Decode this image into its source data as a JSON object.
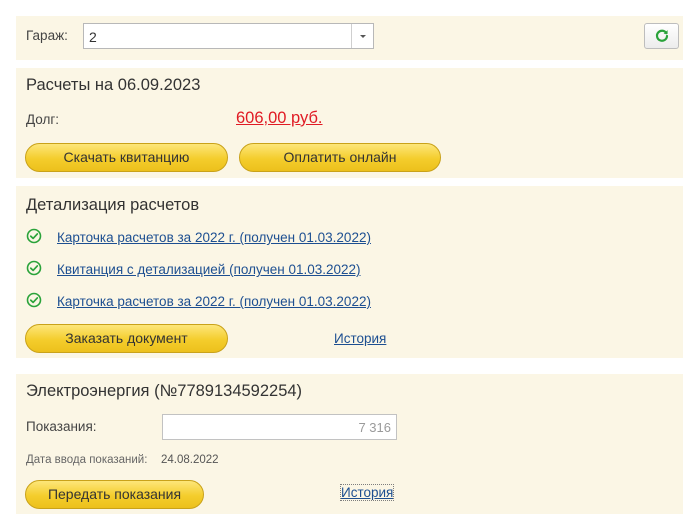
{
  "garage": {
    "label": "Гараж:",
    "selected": "2"
  },
  "calc": {
    "title": "Расчеты на 06.09.2023",
    "debt_label": "Долг:",
    "debt_value": "606,00 руб.",
    "download_label": "Скачать квитанцию",
    "pay_label": "Оплатить онлайн"
  },
  "detail": {
    "title": "Детализация расчетов",
    "documents": [
      {
        "label": "Карточка расчетов за 2022 г. (получен 01.03.2022)"
      },
      {
        "label": "Квитанция с детализацией (получен 01.03.2022)"
      },
      {
        "label": "Карточка расчетов за 2022 г. (получен 01.03.2022)"
      }
    ],
    "order_label": "Заказать документ",
    "history_label": "История"
  },
  "energy": {
    "title": "Электроэнергия (№7789134592254)",
    "readings_label": "Показания:",
    "readings_value": "7 316",
    "date_label": "Дата ввода показаний:",
    "date_value": "24.08.2022",
    "submit_label": "Передать показания",
    "history_label": "История"
  },
  "colors": {
    "panel_bg": "#fbf6e5",
    "button_yellow": "#f4cd2c",
    "debt_red": "#e01b24",
    "link_blue": "#1d4f91",
    "check_green": "#2aa33a"
  },
  "icons": {
    "refresh": "refresh-icon",
    "check": "check-circle-icon",
    "dropdown": "chevron-down-icon"
  }
}
